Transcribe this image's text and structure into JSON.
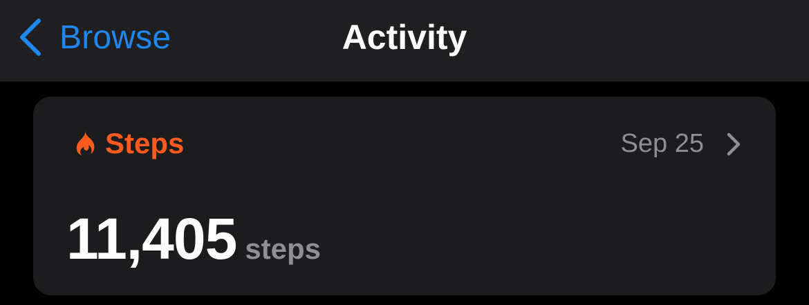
{
  "colors": {
    "accent": "#1e88f0",
    "orange": "#ff5a1f",
    "secondary_text": "#8e8e93"
  },
  "nav": {
    "back_label": "Browse",
    "title": "Activity"
  },
  "card": {
    "icon": "flame-icon",
    "title": "Steps",
    "date": "Sep 25",
    "value": "11,405",
    "unit": "steps"
  }
}
